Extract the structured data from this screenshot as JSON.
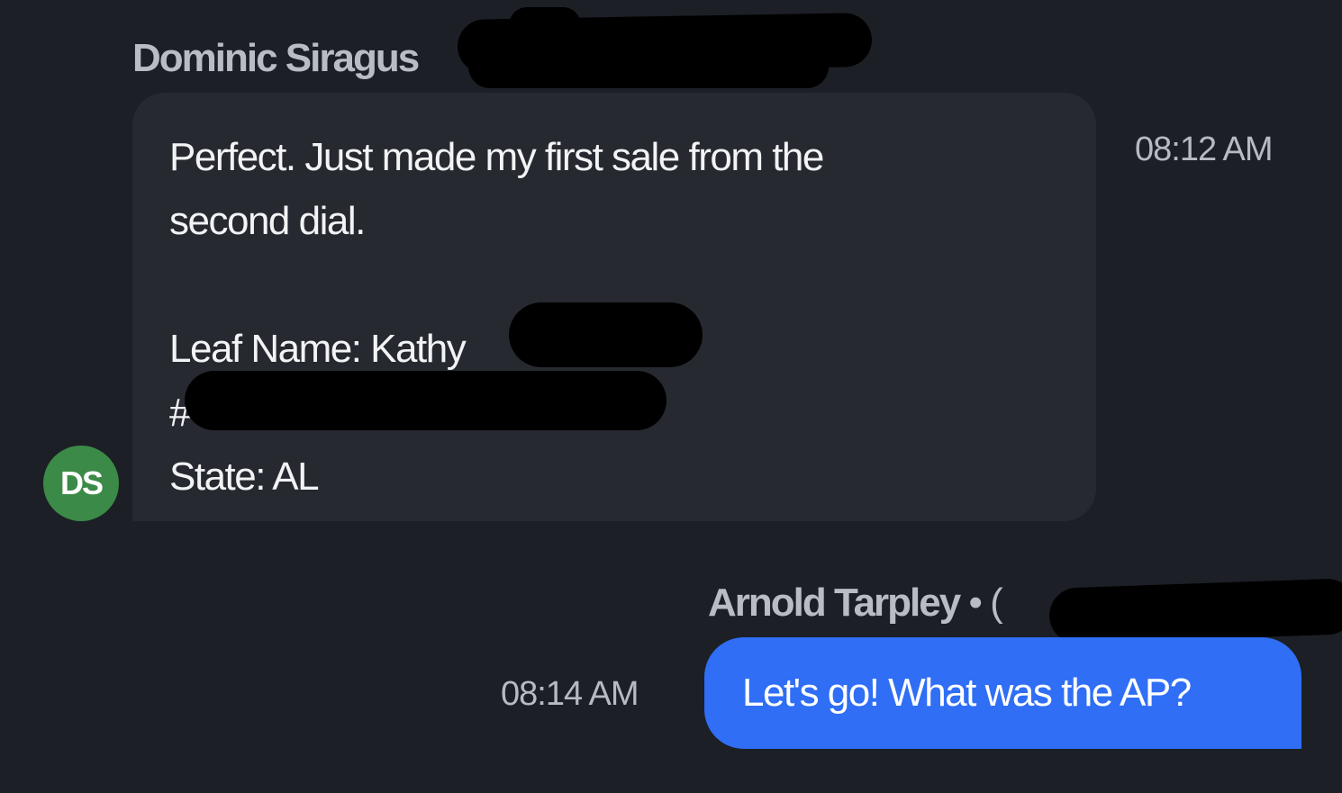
{
  "messages": [
    {
      "sender": "Dominic Siragus",
      "avatar_initials": "DS",
      "lines": [
        "Perfect. Just made my first sale from the",
        "second dial.",
        "",
        "Leaf Name: Kathy",
        "#",
        "State: AL"
      ],
      "time": "08:12 AM",
      "direction": "incoming"
    },
    {
      "sender": "Arnold Tarpley",
      "sender_suffix": " • (",
      "text": "Let's go! What was the AP?",
      "time": "08:14 AM",
      "direction": "outgoing"
    }
  ],
  "colors": {
    "background": "#1c1f26",
    "incoming_bubble": "#272931",
    "outgoing_bubble": "#2f6ef5",
    "avatar": "#3c8a47",
    "muted_text": "#b7bac2"
  }
}
